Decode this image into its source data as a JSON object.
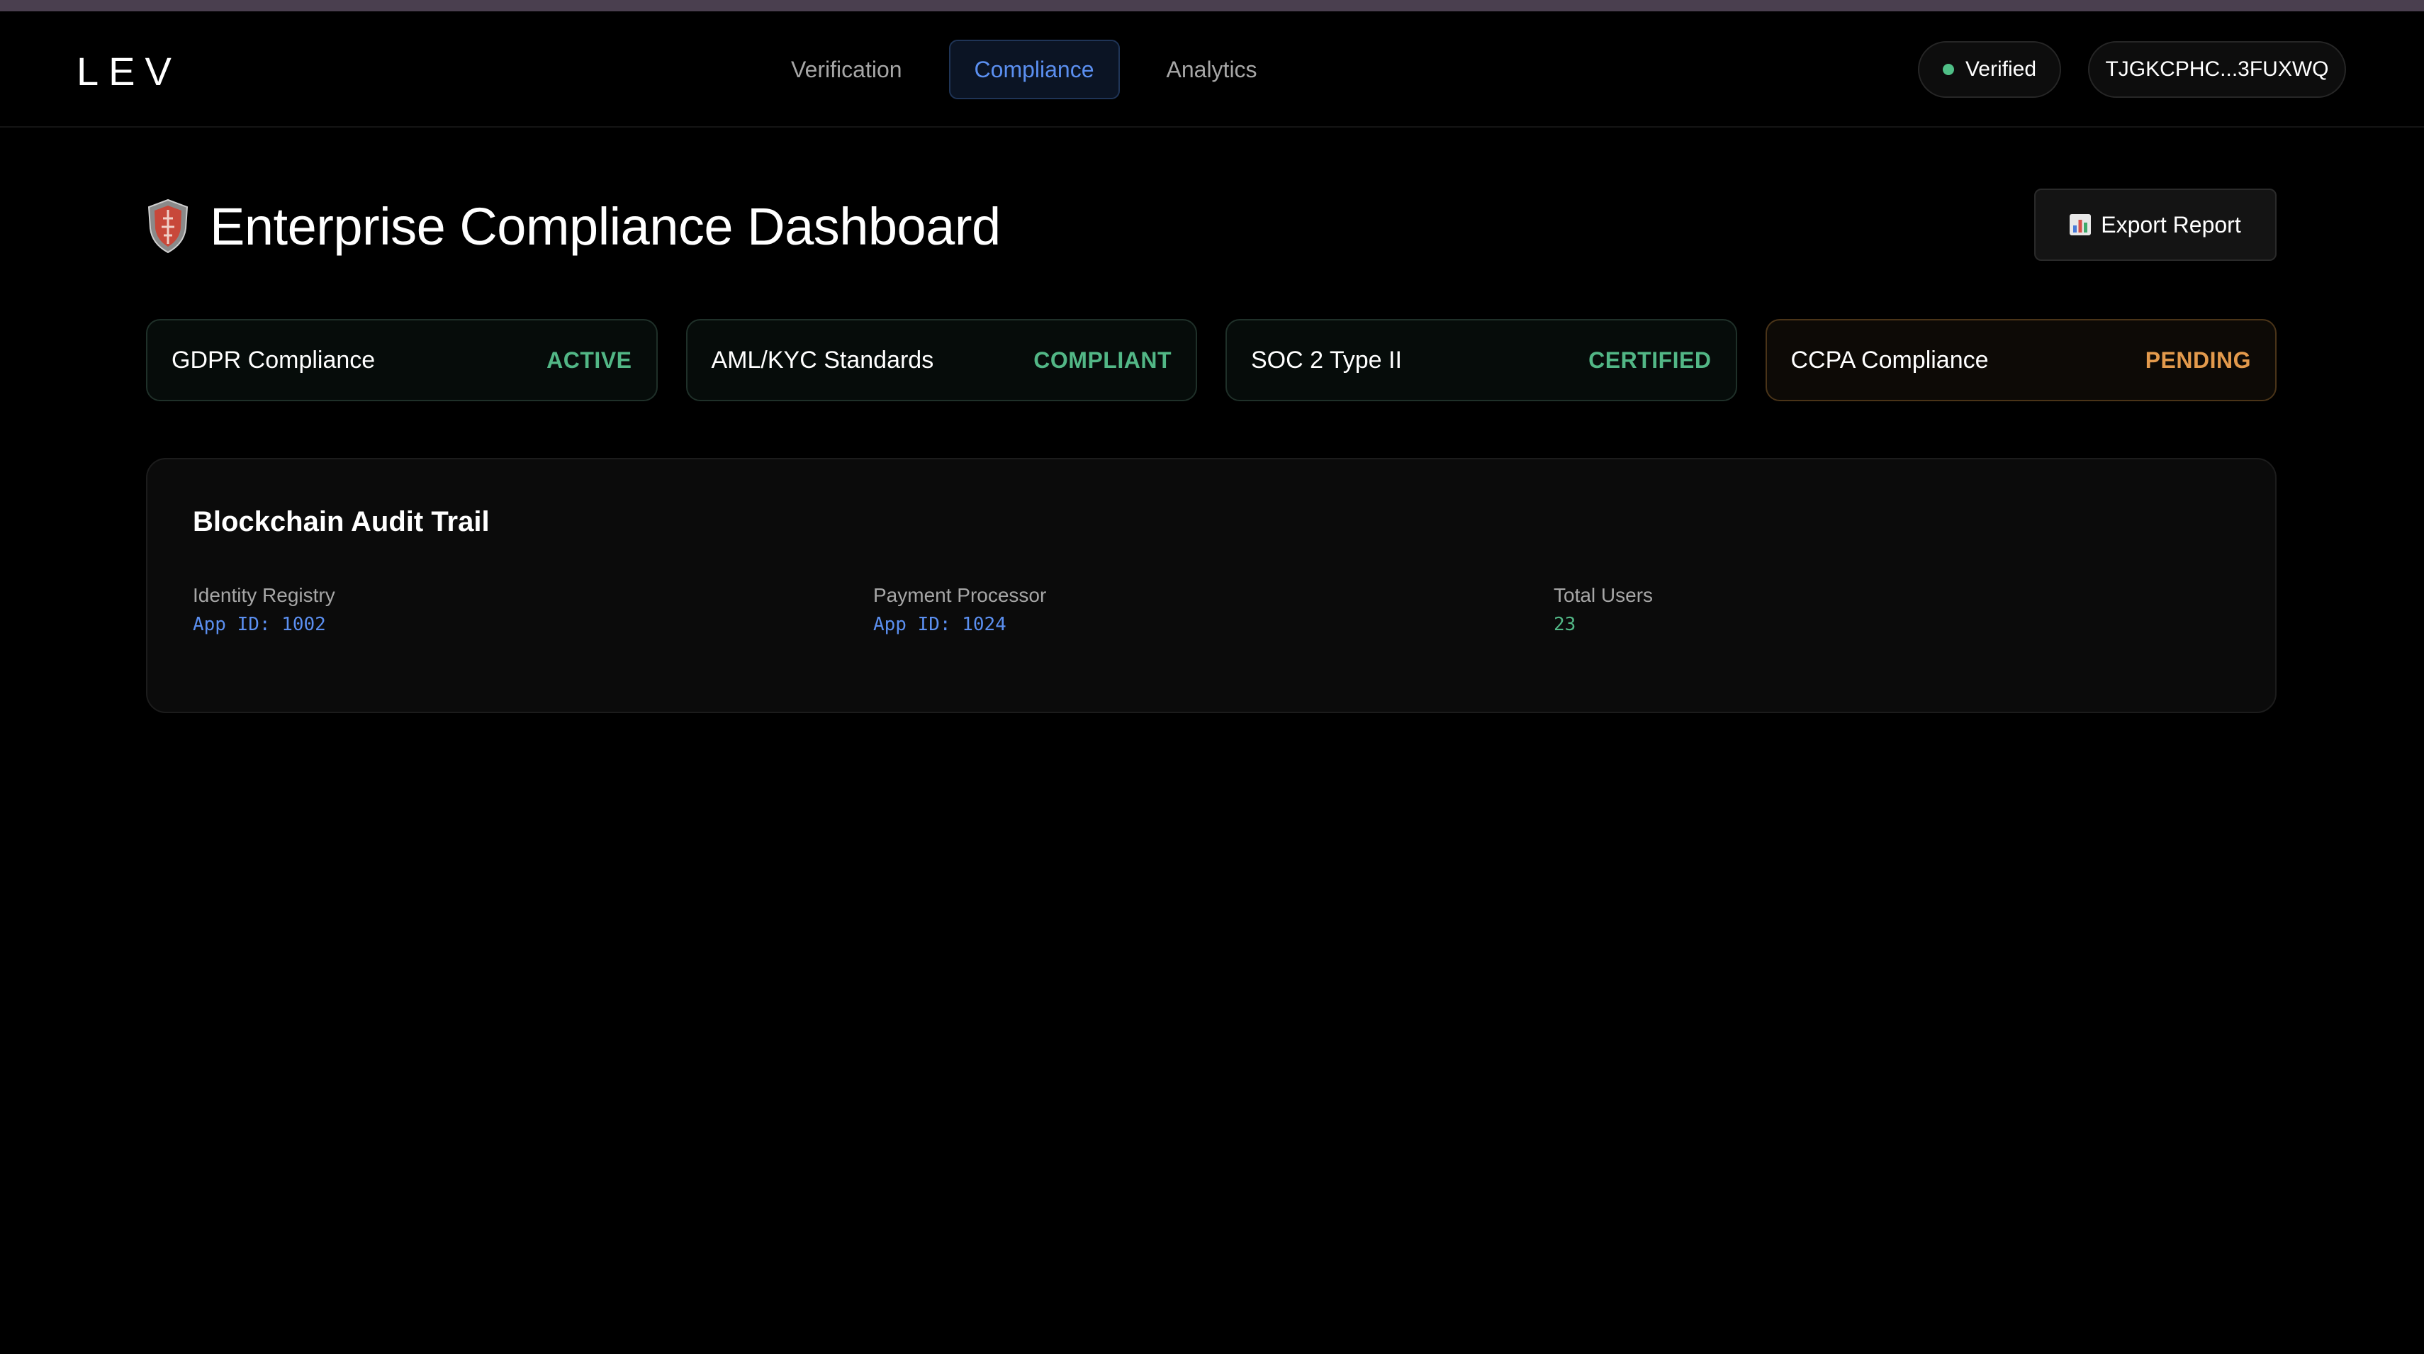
{
  "app": {
    "logo": "LEV"
  },
  "nav": {
    "tabs": [
      {
        "label": "Verification",
        "active": false
      },
      {
        "label": "Compliance",
        "active": true
      },
      {
        "label": "Analytics",
        "active": false
      }
    ]
  },
  "account": {
    "status_label": "Verified",
    "status_color": "#4fbf86",
    "wallet_address": "TJGKCPHC...3FUXWQ"
  },
  "page": {
    "title": "Enterprise Compliance Dashboard",
    "title_icon": "shield-icon",
    "export_label": "Export Report",
    "export_icon": "bar-chart-icon"
  },
  "compliance": [
    {
      "name": "GDPR Compliance",
      "status": "ACTIVE",
      "color": "#52b786"
    },
    {
      "name": "AML/KYC Standards",
      "status": "COMPLIANT",
      "color": "#52b786"
    },
    {
      "name": "SOC 2 Type II",
      "status": "CERTIFIED",
      "color": "#52b786"
    },
    {
      "name": "CCPA Compliance",
      "status": "PENDING",
      "color": "#e39a4c"
    }
  ],
  "audit": {
    "title": "Blockchain Audit Trail",
    "items": [
      {
        "label": "Identity Registry",
        "value": "App ID: 1002"
      },
      {
        "label": "Payment Processor",
        "value": "App ID: 1024"
      },
      {
        "label": "Total Users",
        "value": "23"
      }
    ]
  },
  "colors": {
    "accent_blue": "#5b8ff0",
    "status_green": "#52b786",
    "status_orange": "#e39a4c",
    "background": "#000000"
  }
}
